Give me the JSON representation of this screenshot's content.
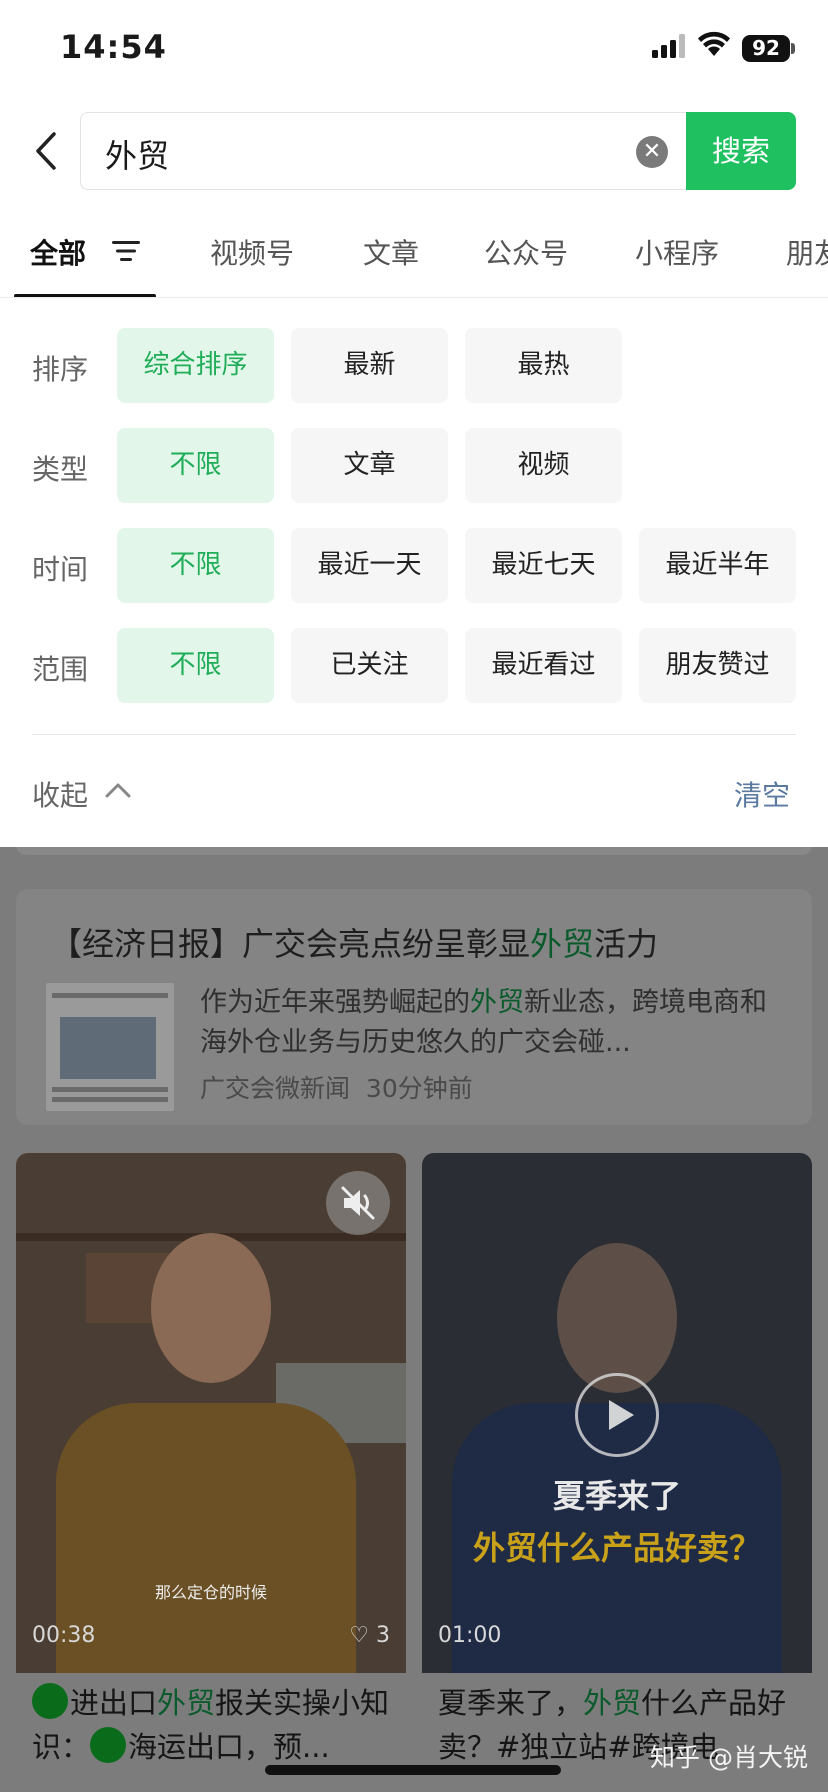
{
  "status_bar": {
    "time": "14:54",
    "battery": "92"
  },
  "search": {
    "query": "外贸",
    "button": "搜索"
  },
  "tabs": [
    "全部",
    "视频号",
    "文章",
    "公众号",
    "小程序",
    "朋友"
  ],
  "filters": {
    "rows": [
      {
        "label": "排序",
        "options": [
          "综合排序",
          "最新",
          "最热"
        ],
        "selected": 0
      },
      {
        "label": "类型",
        "options": [
          "不限",
          "文章",
          "视频"
        ],
        "selected": 0
      },
      {
        "label": "时间",
        "options": [
          "不限",
          "最近一天",
          "最近七天",
          "最近半年"
        ],
        "selected": 0
      },
      {
        "label": "范围",
        "options": [
          "不限",
          "已关注",
          "最近看过",
          "朋友赞过"
        ],
        "selected": 0
      }
    ],
    "collapse": "收起",
    "clear": "清空"
  },
  "article": {
    "title_pre": "【经济日报】广交会亮点纷呈彰显",
    "title_hl": "外贸",
    "title_post": "活力",
    "desc_pre": "作为近年来强势崛起的",
    "desc_hl": "外贸",
    "desc_post": "新业态，跨境电商和海外仓业务与历史悠久的广交会碰...",
    "source": "广交会微新闻",
    "time": "30分钟前"
  },
  "videos": [
    {
      "duration": "00:38",
      "likes": "3",
      "subtitle": "那么定仓的时候",
      "cap_a": "进出口",
      "cap_hl": "外贸",
      "cap_b": "报关实操小知识：",
      "cap_c": "海运出口，预..."
    },
    {
      "duration": "01:00",
      "overlay_line1": "夏季来了",
      "overlay_line2": "外贸什么产品好卖？",
      "cap_a": "夏季来了，",
      "cap_hl": "外贸",
      "cap_b": "什么产品好卖？#独立站#跨境电"
    }
  ],
  "watermark": "知乎 @肖大锐",
  "colors": {
    "accent": "#1fc060",
    "selected_bg": "#e3f6ea",
    "selected_text": "#1fad58",
    "link": "#5a7aa0"
  }
}
